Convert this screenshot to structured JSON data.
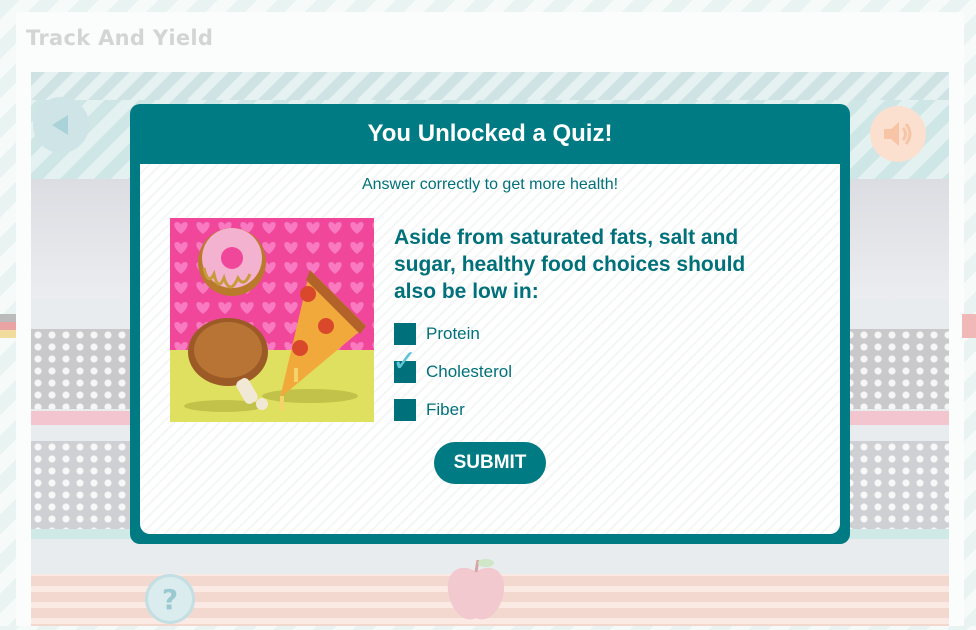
{
  "game": {
    "title": "Track And Yield"
  },
  "quiz": {
    "title": "You Unlocked a Quiz!",
    "subtitle": "Answer correctly to get more health!",
    "image_icon": "junk-food-illustration",
    "question": "Aside from saturated fats, salt and sugar, healthy food choices should also be low in:",
    "options": [
      {
        "label": "Protein",
        "checked": false
      },
      {
        "label": "Cholesterol",
        "checked": true
      },
      {
        "label": "Fiber",
        "checked": false
      }
    ],
    "submit_label": "SUBMIT"
  },
  "controls": {
    "back_icon": "back-arrow-icon",
    "sound_icon": "speaker-icon",
    "help_text": "?",
    "health_icon": "apple-icon"
  },
  "colors": {
    "primary": "#007a83",
    "text": "#00717a",
    "check": "#5fc5d6",
    "image_bg": "#f0479a",
    "ground": "#e0e060"
  }
}
